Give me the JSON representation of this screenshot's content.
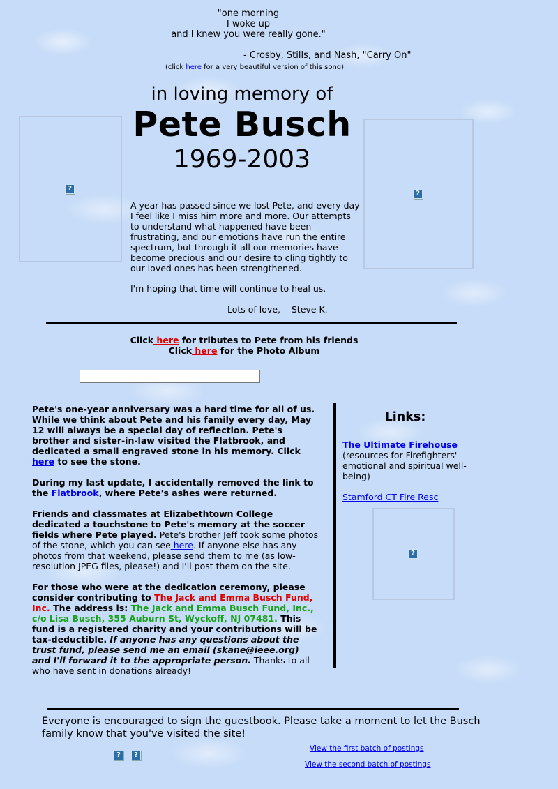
{
  "quote": {
    "line1": "\"one morning",
    "line2": "I woke up",
    "line3": "and I knew you were really gone.\"",
    "credit": "- Crosby, Stills, and Nash, \"Carry On\"",
    "note_before": "(click ",
    "note_link": "here",
    "note_after": " for a very beautiful version of this song)"
  },
  "header": {
    "memory": "in loving memory of",
    "name": "Pete Busch",
    "years": "1969-2003"
  },
  "intro": {
    "text": "A year has passed since we lost Pete, and every day I feel like I miss him more and more.  Our attempts to understand what happened have been frustrating, and our emotions have run the entire spectrum, but through it all our memories have become precious and our desire to cling tightly to our loved ones has been strengthened.",
    "hope": "I'm hoping that time will continue to heal us.",
    "signoff": "Lots of love,    Steve K."
  },
  "nav": {
    "click1": "Click",
    "here1": " here",
    "rest1": " for tributes to Pete from his friends",
    "click2": "Click",
    "here2": " here",
    "rest2": " for the Photo Album"
  },
  "news": {
    "p1_a": "Pete's one-year anniversary was a hard time for all of us.  While we think about Pete and his family every day, May 12 will always be a special day of reflection.   Pete's brother and sister-in-law visited the Flatbrook, and dedicated a small engraved stone in his memory.  Click ",
    "p1_link": "here",
    "p1_b": " to see the stone.",
    "p2_a": "During my last update, I accidentally removed the link to the ",
    "p2_link": "Flatbrook",
    "p2_b": ", where Pete's ashes were returned.",
    "p3_bold": "Friends and classmates at Elizabethtown College dedicated a touchstone to Pete's memory at the soccer fields where Pete played.",
    "p3_a": "  Pete's brother Jeff took some photos of the stone, which you can see",
    "p3_link": " here",
    "p3_b": ".   If anyone else has any photos from that weekend, please send them to me (as low-resolution JPEG files, please!) and I'll post them on the site.",
    "p4_a": "For those who were at the dedication ceremony, please consider contributing to ",
    "p4_fund": "The Jack and Emma Busch Fund, Inc.",
    "p4_b": "  The address is:  ",
    "p4_address": "The Jack and Emma Busch Fund, Inc., c/o Lisa Busch, 355 Auburn St, Wyckoff, NJ 07481.",
    "p4_c": "  This fund is a registered charity and your contributions will be tax-deductible.  ",
    "p4_italic": "If anyone has any questions about the trust fund, please send me an email (skane@ieee.org) and I'll forward it to the appropriate person.",
    "p4_d": "  Thanks to all who have sent in donations already!"
  },
  "links": {
    "title": "Links:",
    "firehouse": "The Ultimate Firehouse",
    "firehouse_desc": "(resources for Firefighters' emotional and spiritual well-being)",
    "stamford": "Stamford CT Fire Resc"
  },
  "guestbook": {
    "text": "Everyone is encouraged to sign the guestbook.  Please take a moment to let the Busch family know that you've visited the site!",
    "postings1": "View the first batch of postings",
    "postings2": "View the second batch of postings"
  },
  "icons": {
    "broken_image_glyph": "?"
  },
  "colors": {
    "background": "#c7dcf8",
    "link": "#0000ee",
    "red_link": "#e00000",
    "green_text": "#19a019"
  }
}
